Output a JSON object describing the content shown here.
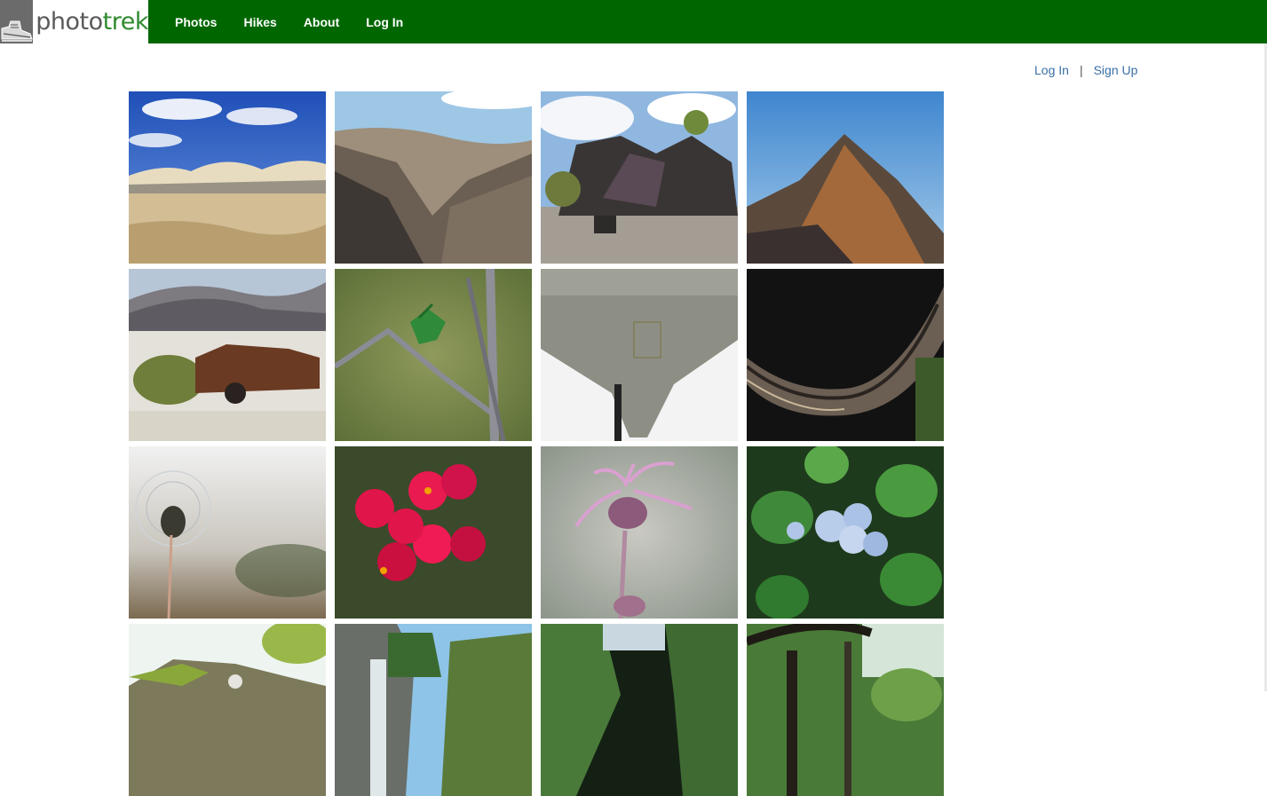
{
  "brand": {
    "name_part1": "photo",
    "name_part2": "trek",
    "logo_icon": "hiking-boot-icon"
  },
  "nav": {
    "items": [
      {
        "label": "Photos"
      },
      {
        "label": "Hikes"
      },
      {
        "label": "About"
      },
      {
        "label": "Log In"
      }
    ]
  },
  "auth": {
    "login_label": "Log In",
    "separator": "|",
    "signup_label": "Sign Up"
  },
  "colors": {
    "nav_bg": "#006600",
    "link": "#3a6ea5"
  },
  "gallery": {
    "photos": [
      {
        "subject": "sand-dunes"
      },
      {
        "subject": "canyon"
      },
      {
        "subject": "volcanic-rocks"
      },
      {
        "subject": "mountain-peak"
      },
      {
        "subject": "rusted-car"
      },
      {
        "subject": "thorny-branch"
      },
      {
        "subject": "airplane-underside"
      },
      {
        "subject": "carved-wood"
      },
      {
        "subject": "dandelion"
      },
      {
        "subject": "red-flowers"
      },
      {
        "subject": "pink-flower"
      },
      {
        "subject": "blue-hydrangea"
      },
      {
        "subject": "mossy-rocks"
      },
      {
        "subject": "waterfall"
      },
      {
        "subject": "green-ravine"
      },
      {
        "subject": "forest-trees"
      }
    ]
  }
}
